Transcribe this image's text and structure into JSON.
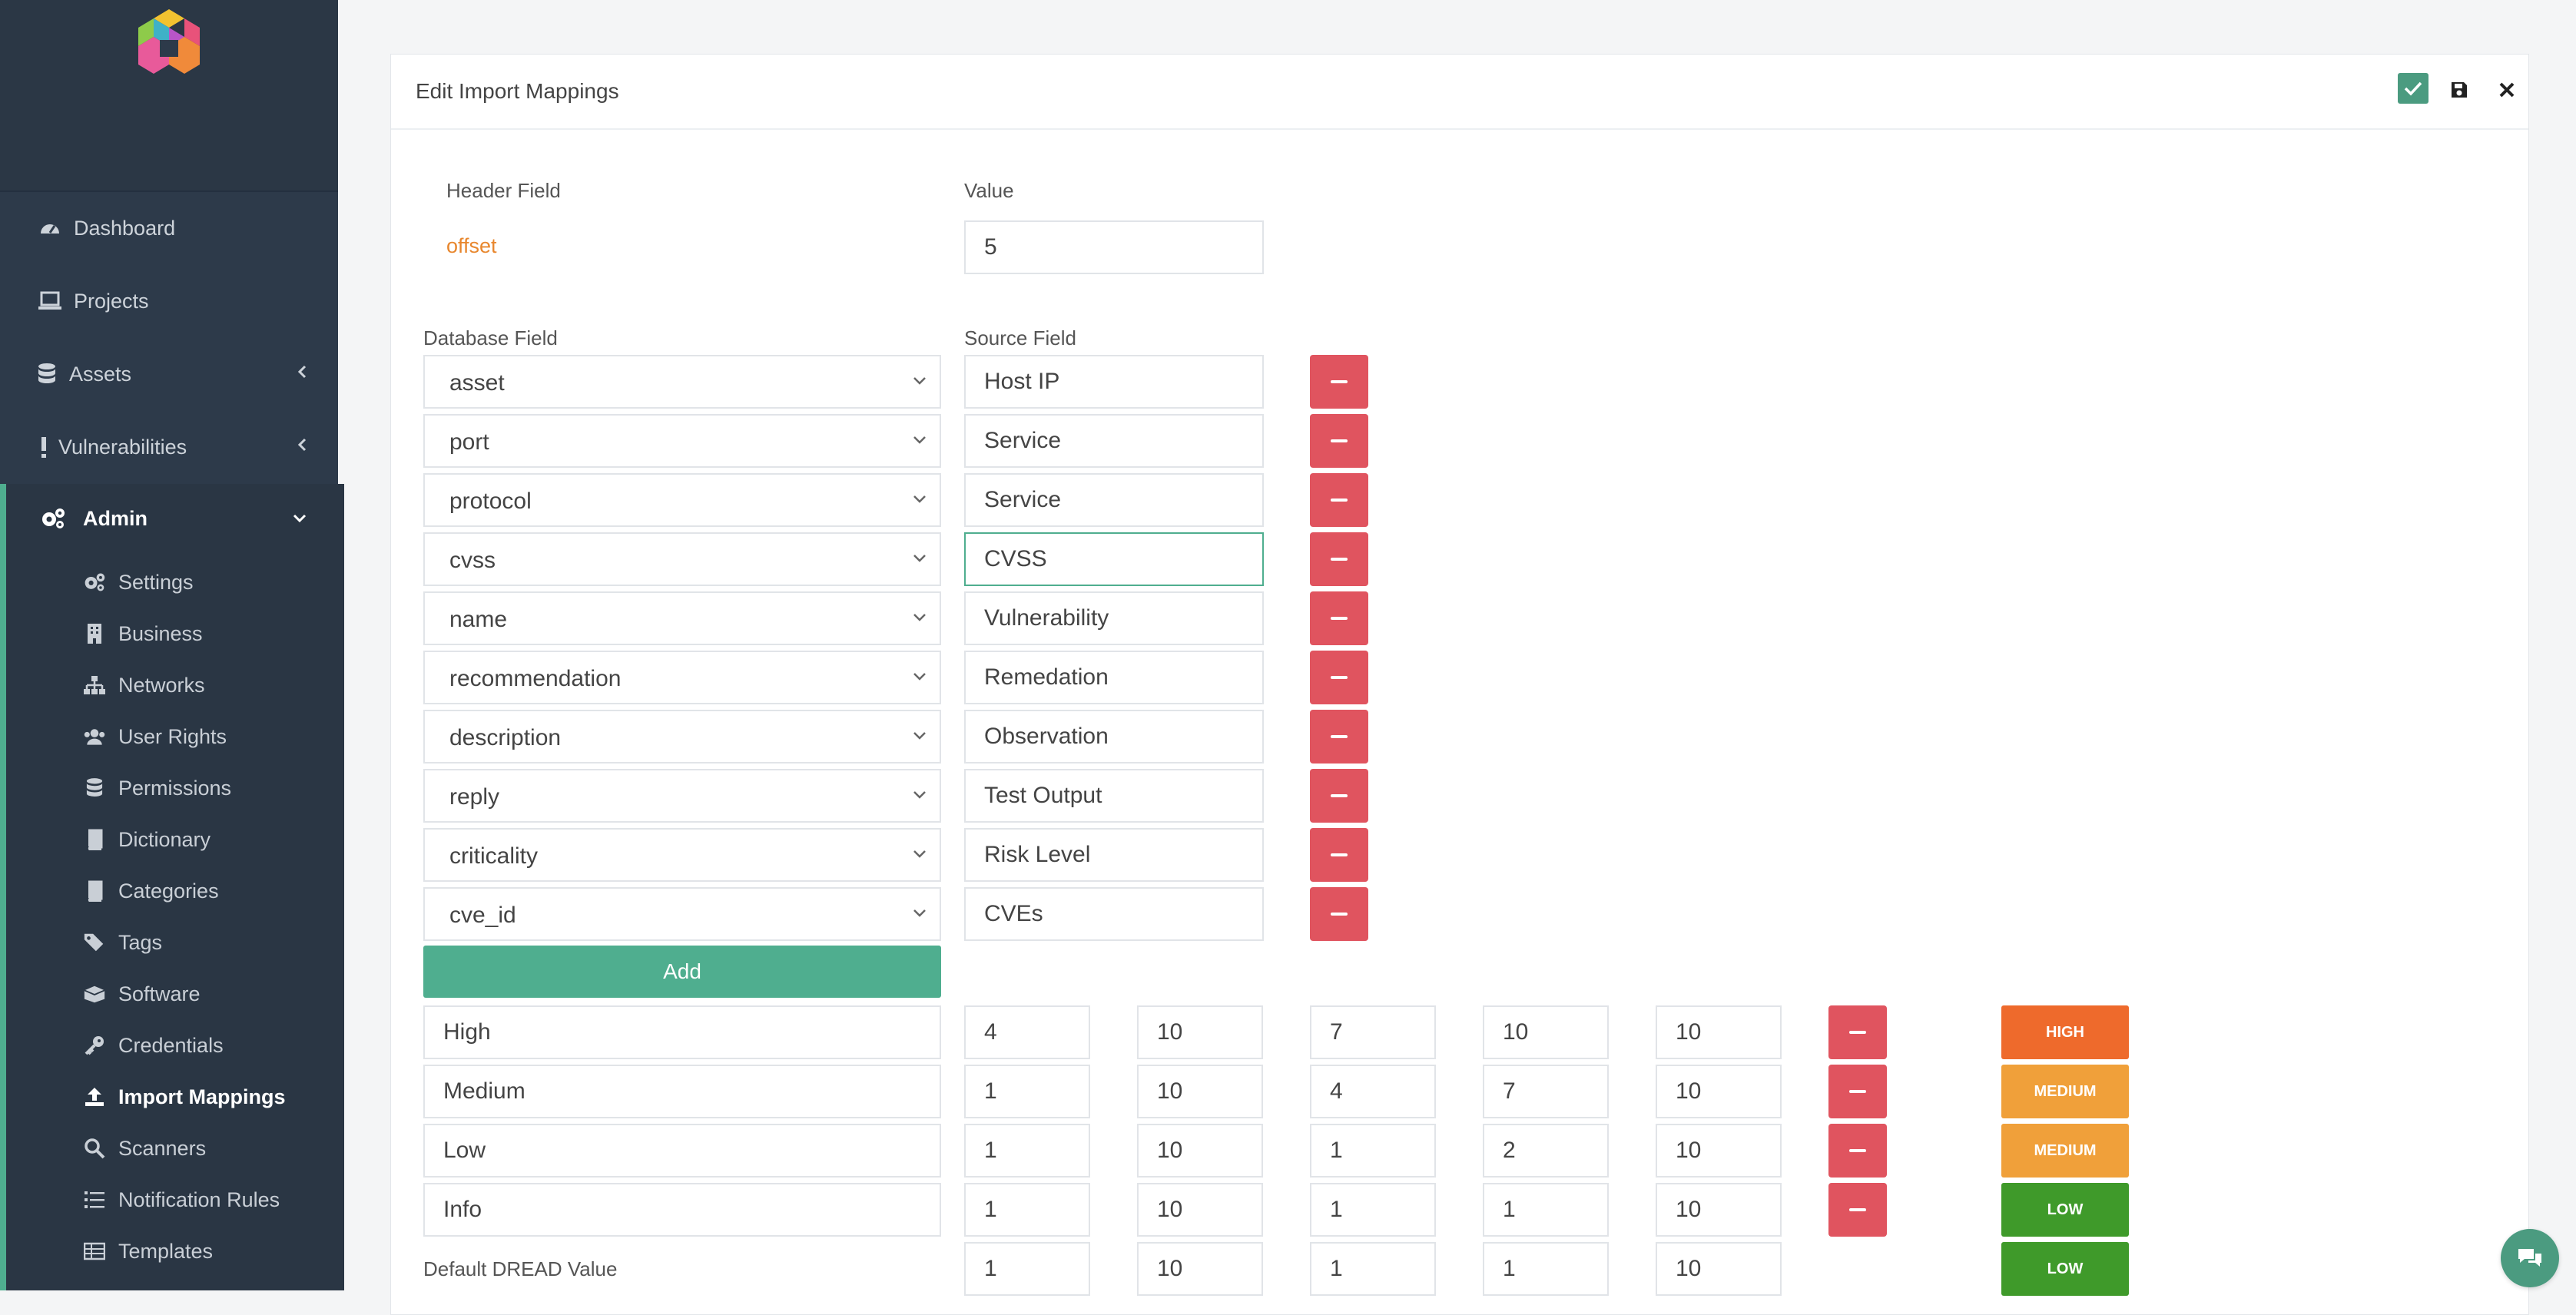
{
  "sidebar": {
    "items": [
      {
        "label": "Dashboard",
        "icon": "dashboard-icon"
      },
      {
        "label": "Projects",
        "icon": "laptop-icon"
      },
      {
        "label": "Assets",
        "icon": "database-icon"
      },
      {
        "label": "Vulnerabilities",
        "icon": "exclamation-icon"
      },
      {
        "label": "Admin",
        "icon": "cogs-icon"
      }
    ],
    "admin_items": [
      {
        "label": "Settings",
        "icon": "cogs-icon"
      },
      {
        "label": "Business",
        "icon": "building-icon"
      },
      {
        "label": "Networks",
        "icon": "sitemap-icon"
      },
      {
        "label": "User Rights",
        "icon": "users-icon"
      },
      {
        "label": "Permissions",
        "icon": "database-icon"
      },
      {
        "label": "Dictionary",
        "icon": "book-icon"
      },
      {
        "label": "Categories",
        "icon": "book-icon"
      },
      {
        "label": "Tags",
        "icon": "tags-icon"
      },
      {
        "label": "Software",
        "icon": "box-icon"
      },
      {
        "label": "Credentials",
        "icon": "key-icon"
      },
      {
        "label": "Import Mappings",
        "icon": "upload-icon"
      },
      {
        "label": "Scanners",
        "icon": "search-icon"
      },
      {
        "label": "Notification Rules",
        "icon": "list-icon"
      },
      {
        "label": "Templates",
        "icon": "table-icon"
      }
    ]
  },
  "card": {
    "title": "Edit Import Mappings",
    "header_field_label": "Header Field",
    "value_label": "Value",
    "offset_label": "offset",
    "offset_value": "5",
    "database_field_label": "Database Field",
    "source_field_label": "Source Field",
    "mappings": [
      {
        "db": "asset",
        "source": "Host IP"
      },
      {
        "db": "port",
        "source": "Service"
      },
      {
        "db": "protocol",
        "source": "Service"
      },
      {
        "db": "cvss",
        "source": "CVSS"
      },
      {
        "db": "name",
        "source": "Vulnerability"
      },
      {
        "db": "recommendation",
        "source": "Remedation"
      },
      {
        "db": "description",
        "source": "Observation"
      },
      {
        "db": "reply",
        "source": "Test Output"
      },
      {
        "db": "criticality",
        "source": "Risk Level"
      },
      {
        "db": "cve_id",
        "source": "CVEs"
      }
    ],
    "add_label": "Add",
    "dread_rows": [
      {
        "name": "High",
        "v": [
          "4",
          "10",
          "7",
          "10",
          "10"
        ],
        "badge": "HIGH"
      },
      {
        "name": "Medium",
        "v": [
          "1",
          "10",
          "4",
          "7",
          "10"
        ],
        "badge": "MEDIUM"
      },
      {
        "name": "Low",
        "v": [
          "1",
          "10",
          "1",
          "2",
          "10"
        ],
        "badge": "MEDIUM"
      },
      {
        "name": "Info",
        "v": [
          "1",
          "10",
          "1",
          "1",
          "10"
        ],
        "badge": "LOW"
      }
    ],
    "default_dread_label": "Default DREAD Value",
    "default_dread": {
      "v": [
        "1",
        "10",
        "1",
        "1",
        "10"
      ],
      "badge": "LOW"
    }
  },
  "colors": {
    "accent": "#4fae8f",
    "danger": "#e0545f",
    "high": "#ee6a2c",
    "medium": "#f0a03a",
    "low": "#3f9a2a"
  }
}
